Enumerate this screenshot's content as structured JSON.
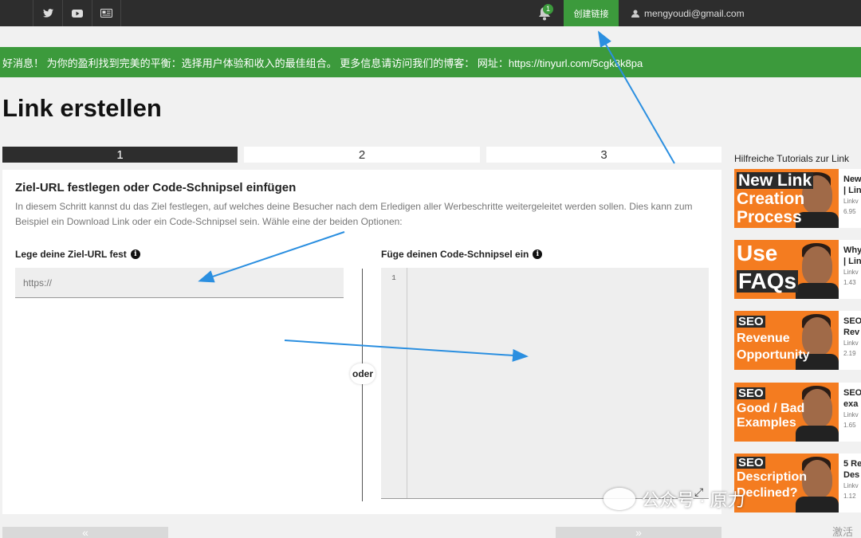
{
  "topbar": {
    "social": [
      {
        "icon": "twitter-icon"
      },
      {
        "icon": "youtube-icon"
      },
      {
        "icon": "news-icon"
      }
    ],
    "notification_count": "1",
    "create_link_label": "创建链接",
    "user_email": "mengyoudi@gmail.com"
  },
  "announcement": "好消息！ 为你的盈利找到完美的平衡：选择用户体验和收入的最佳组合。 更多信息请访问我们的博客： 网址：https://tinyurl.com/5cgk8k8pa",
  "page": {
    "title": "Link erstellen",
    "steps": [
      "1",
      "2",
      "3"
    ],
    "active_step": 1
  },
  "panel": {
    "heading": "Ziel-URL festlegen oder Code-Schnipsel einfügen",
    "description": "In diesem Schritt kannst du das Ziel festlegen, auf welches deine Besucher nach dem Erledigen aller Werbeschritte weitergeleitet werden sollen. Dies kann zum Beispiel ein Download Link oder ein Code-Schnipsel sein. Wähle eine der beiden Optionen:",
    "url_label": "Lege deine Ziel-URL fest",
    "url_placeholder": "https://",
    "or_label": "oder",
    "code_label": "Füge deinen Code-Schnipsel ein",
    "code_line_number": "1"
  },
  "bottom_nav": {
    "prev_icon": "double-chevron-left-icon",
    "next_icon": "double-chevron-right-icon"
  },
  "sidebar": {
    "title": "Hilfreiche Tutorials zur Link",
    "tutorials": [
      {
        "thumb_line1": "New Link",
        "thumb_line2": "Creation",
        "thumb_line3": "Process",
        "name1": "New",
        "name2": "| Lin",
        "channel": "Linkv",
        "count": "6.95"
      },
      {
        "thumb_line1": "Use",
        "thumb_line2": "FAQs",
        "thumb_line3": "",
        "name1": "Why",
        "name2": "| Lin",
        "channel": "Linkv",
        "count": "1.43"
      },
      {
        "thumb_line1": "SEO",
        "thumb_line2": "Revenue",
        "thumb_line3": "Opportunity",
        "name1": "SEO",
        "name2": "Rev",
        "channel": "Linkv",
        "count": "2.19"
      },
      {
        "thumb_line1": "SEO",
        "thumb_line2": "Good / Bad",
        "thumb_line3": "Examples",
        "name1": "SEO",
        "name2": "exa",
        "channel": "Linkv",
        "count": "1.65"
      },
      {
        "thumb_line1": "SEO",
        "thumb_line2": "Description",
        "thumb_line3": "Declined?",
        "name1": "5 Re",
        "name2": "Des",
        "channel": "Linkv",
        "count": "1.12"
      }
    ]
  },
  "watermark": {
    "wechat_text": "公众号 · 原力",
    "activate_text": "激活"
  },
  "colors": {
    "accent_green": "#3c9a3c",
    "topbar": "#2d2d2d",
    "thumb_orange": "#f47c20",
    "arrow_blue": "#2b8fe0"
  }
}
